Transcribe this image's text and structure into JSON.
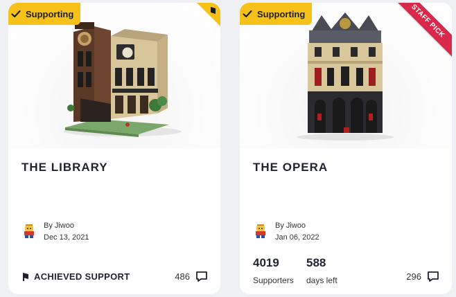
{
  "cards": [
    {
      "badge": "Supporting",
      "title": "THE LIBRARY",
      "author_prefix": "By",
      "author": "Jiwoo",
      "date": "Dec 13, 2021",
      "status": "ACHIEVED SUPPORT",
      "comments": "486"
    },
    {
      "badge": "Supporting",
      "ribbon": "STAFF PICK",
      "title": "THE OPERA",
      "author_prefix": "By",
      "author": "Jiwoo",
      "date": "Jan 06, 2022",
      "supporters": "4019",
      "supporters_label": "Supporters",
      "days_left": "588",
      "days_left_label": "days left",
      "comments": "296"
    }
  ],
  "colors": {
    "badge_yellow": "#f6c21a",
    "staff_pick_red": "#d8284c",
    "page_bg": "#eef0f4"
  },
  "icons": [
    "check-icon",
    "flag-icon",
    "lego-avatar-icon",
    "comment-icon",
    "achieved-flag-icon"
  ]
}
